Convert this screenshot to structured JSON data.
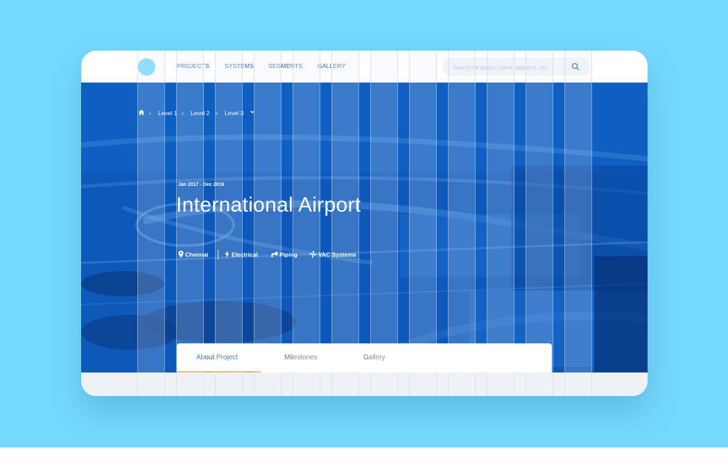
{
  "nav": {
    "links": [
      "PROJECTS",
      "SYSTEMS",
      "SEGMENTS",
      "GALLERY"
    ]
  },
  "search": {
    "placeholder": "Search for project name, keyword, etc..",
    "icon": "search-icon"
  },
  "breadcrumb": {
    "home_icon": "home-icon",
    "levels": [
      "Level 1",
      "Level 2",
      "Level 3"
    ]
  },
  "project": {
    "date_range": "Jan 2017 - Dec 2019",
    "title": "International Airport",
    "location": "Chennai",
    "tags": [
      "Electrical",
      "Piping",
      "VAC Systems"
    ]
  },
  "tabs": [
    "About Project",
    "Milestones",
    "Gallery"
  ],
  "colors": {
    "background": "#75d9fd",
    "accent_blue": "#2a65b8",
    "hero_blue": "#0c55b8",
    "tab_underline": "#f0b34a"
  }
}
